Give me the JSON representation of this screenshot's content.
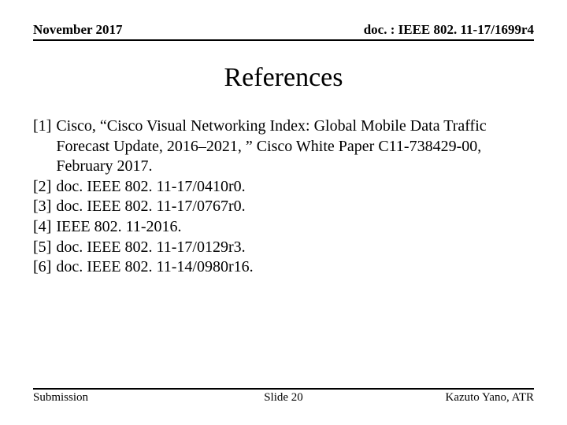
{
  "header": {
    "left": "November 2017",
    "right": "doc. : IEEE 802. 11-17/1699r4"
  },
  "title": "References",
  "refs": [
    {
      "num": "[1]",
      "text": "Cisco, “Cisco Visual Networking Index: Global Mobile Data Traffic Forecast Update, 2016–2021, ” Cisco White Paper C11-738429-00, February 2017."
    },
    {
      "num": "[2]",
      "text": "doc. IEEE 802. 11-17/0410r0."
    },
    {
      "num": "[3]",
      "text": "doc. IEEE 802. 11-17/0767r0."
    },
    {
      "num": "[4]",
      "text": "IEEE 802. 11-2016."
    },
    {
      "num": "[5]",
      "text": "doc. IEEE 802. 11-17/0129r3."
    },
    {
      "num": "[6]",
      "text": "doc. IEEE 802. 11-14/0980r16."
    }
  ],
  "footer": {
    "left": "Submission",
    "center": "Slide 20",
    "right": "Kazuto Yano, ATR"
  }
}
